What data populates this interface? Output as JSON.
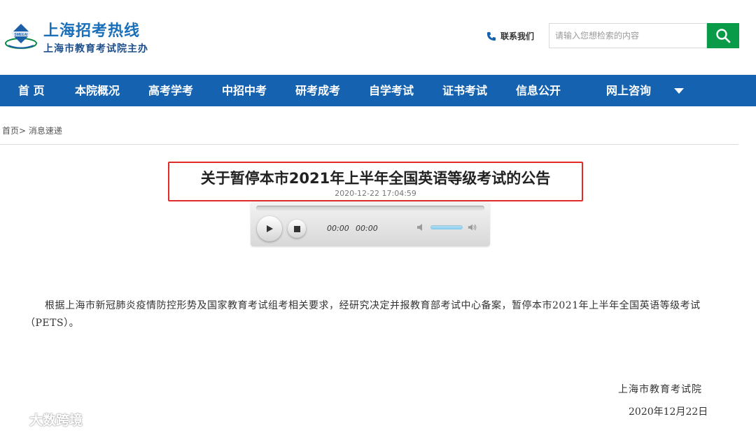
{
  "header": {
    "logo_mark_text": "SMEEAI",
    "site_title": "上海招考热线",
    "site_subtitle": "上海市教育考试院主办",
    "contact_label": "联系我们",
    "search_placeholder": "请输入您想检索的内容",
    "search_icon": "search-icon",
    "brand_color": "#1563b0",
    "search_button_color": "#0a9b48"
  },
  "nav": {
    "items": [
      {
        "label": "首 页"
      },
      {
        "label": "本院概况"
      },
      {
        "label": "高考学考"
      },
      {
        "label": "中招中考"
      },
      {
        "label": "研考成考"
      },
      {
        "label": "自学考试"
      },
      {
        "label": "证书考试"
      },
      {
        "label": "信息公开"
      },
      {
        "label": "网上咨询"
      }
    ],
    "more_icon": "caret-down-icon"
  },
  "breadcrumb": {
    "home": "首页>",
    "current": "消息速递"
  },
  "article": {
    "title": "关于暂停本市2021年上半年全国英语等级考试的公告",
    "date": "2020-12-22 17:04:59",
    "highlight_color": "#e02b2b",
    "body": "根据上海市新冠肺炎疫情防控形势及国家教育考试组考相关要求，经研究决定并报教育部考试中心备案，暂停本市2021年上半年全国英语等级考试（PETS）。",
    "signature_org": "上海市教育考试院",
    "signature_date": "2020年12月22日"
  },
  "audio_player": {
    "current_time": "00:00",
    "duration": "00:00",
    "progress": 0,
    "volume": 1.0
  },
  "watermark": {
    "text": "大数跨境"
  }
}
